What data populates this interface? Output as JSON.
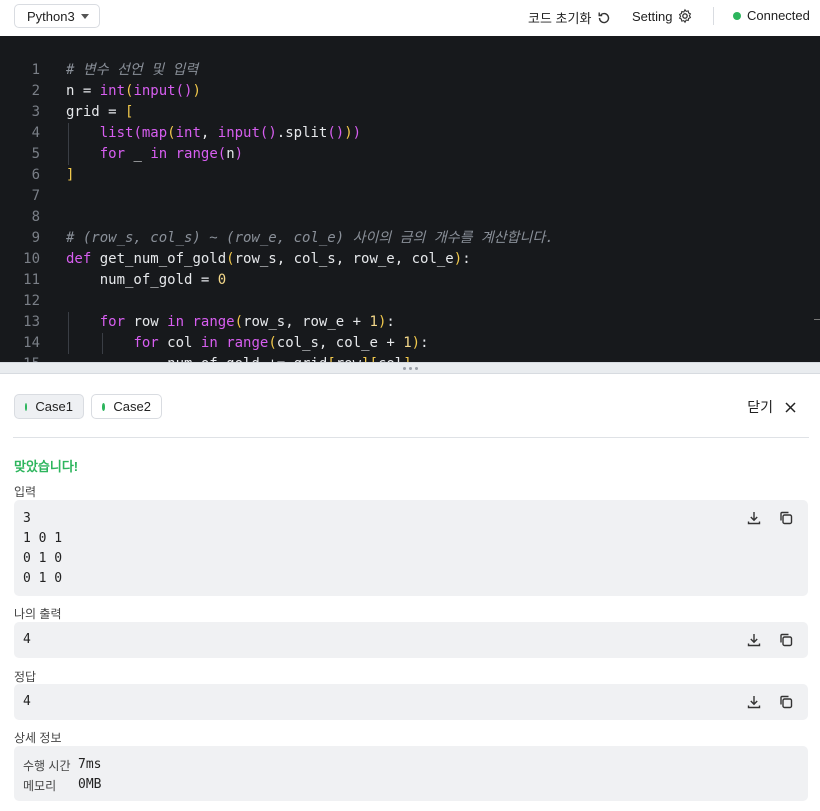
{
  "toolbar": {
    "language": "Python3",
    "reset_label": "코드 초기화",
    "setting_label": "Setting",
    "connection_status": "Connected",
    "status_color": "#2db55d"
  },
  "editor": {
    "lines": [
      {
        "n": "1",
        "tokens": [
          [
            "c-com",
            "# 변수 선언 및 입력"
          ]
        ]
      },
      {
        "n": "2",
        "tokens": [
          [
            "c-txt",
            "n = "
          ],
          [
            "c-fn",
            "int"
          ],
          [
            "c-br1",
            "("
          ],
          [
            "c-fn",
            "input"
          ],
          [
            "c-br2",
            "()"
          ],
          [
            "c-br1",
            ")"
          ]
        ]
      },
      {
        "n": "3",
        "tokens": [
          [
            "c-txt",
            "grid = "
          ],
          [
            "c-br1",
            "["
          ]
        ]
      },
      {
        "n": "4",
        "tokens": [
          [
            "c-txt",
            "    "
          ],
          [
            "c-fn",
            "list"
          ],
          [
            "c-br2",
            "("
          ],
          [
            "c-fn",
            "map"
          ],
          [
            "c-br1",
            "("
          ],
          [
            "c-fn",
            "int"
          ],
          [
            "c-txt",
            ", "
          ],
          [
            "c-fn",
            "input"
          ],
          [
            "c-br2",
            "()"
          ],
          [
            "c-txt",
            ".split"
          ],
          [
            "c-br2",
            "()"
          ],
          [
            "c-br1",
            ")"
          ],
          [
            "c-br2",
            ")"
          ]
        ]
      },
      {
        "n": "5",
        "tokens": [
          [
            "c-txt",
            "    "
          ],
          [
            "c-kw",
            "for"
          ],
          [
            "c-txt",
            " _ "
          ],
          [
            "c-kw",
            "in"
          ],
          [
            "c-txt",
            " "
          ],
          [
            "c-fn",
            "range"
          ],
          [
            "c-br2",
            "("
          ],
          [
            "c-txt",
            "n"
          ],
          [
            "c-br2",
            ")"
          ]
        ]
      },
      {
        "n": "6",
        "tokens": [
          [
            "c-br1",
            "]"
          ]
        ]
      },
      {
        "n": "7",
        "tokens": []
      },
      {
        "n": "8",
        "tokens": []
      },
      {
        "n": "9",
        "tokens": [
          [
            "c-com",
            "# (row_s, col_s) ~ (row_e, col_e) 사이의 금의 개수를 계산합니다."
          ]
        ]
      },
      {
        "n": "10",
        "tokens": [
          [
            "c-kw",
            "def"
          ],
          [
            "c-txt",
            " get_num_of_gold"
          ],
          [
            "c-br1",
            "("
          ],
          [
            "c-txt",
            "row_s, col_s, row_e, col_e"
          ],
          [
            "c-br1",
            ")"
          ],
          [
            "c-txt",
            ":"
          ]
        ]
      },
      {
        "n": "11",
        "tokens": [
          [
            "c-txt",
            "    num_of_gold = "
          ],
          [
            "c-num",
            "0"
          ]
        ]
      },
      {
        "n": "12",
        "tokens": []
      },
      {
        "n": "13",
        "tokens": [
          [
            "c-txt",
            "    "
          ],
          [
            "c-kw",
            "for"
          ],
          [
            "c-txt",
            " row "
          ],
          [
            "c-kw",
            "in"
          ],
          [
            "c-txt",
            " "
          ],
          [
            "c-fn",
            "range"
          ],
          [
            "c-br1",
            "("
          ],
          [
            "c-txt",
            "row_s, row_e + "
          ],
          [
            "c-num",
            "1"
          ],
          [
            "c-br1",
            ")"
          ],
          [
            "c-txt",
            ":"
          ]
        ]
      },
      {
        "n": "14",
        "tokens": [
          [
            "c-txt",
            "        "
          ],
          [
            "c-kw",
            "for"
          ],
          [
            "c-txt",
            " col "
          ],
          [
            "c-kw",
            "in"
          ],
          [
            "c-txt",
            " "
          ],
          [
            "c-fn",
            "range"
          ],
          [
            "c-br1",
            "("
          ],
          [
            "c-txt",
            "col_s, col_e + "
          ],
          [
            "c-num",
            "1"
          ],
          [
            "c-br1",
            ")"
          ],
          [
            "c-txt",
            ":"
          ]
        ]
      },
      {
        "n": "15",
        "tokens": [
          [
            "c-txt",
            "            num_of_gold += grid"
          ],
          [
            "c-br1",
            "["
          ],
          [
            "c-txt",
            "row"
          ],
          [
            "c-br1",
            "]["
          ],
          [
            "c-txt",
            "col"
          ],
          [
            "c-br1",
            "]"
          ]
        ]
      }
    ]
  },
  "panel": {
    "cases": [
      {
        "label": "Case1",
        "status_color": "#2db55d"
      },
      {
        "label": "Case2",
        "status_color": "#2db55d"
      }
    ],
    "close_label": "닫기",
    "result_message": "맞았습니다!",
    "input_label": "입력",
    "input_value": "3\n1 0 1\n0 1 0\n0 1 0",
    "my_output_label": "나의 출력",
    "my_output_value": "4",
    "answer_label": "정답",
    "answer_value": "4",
    "detail_label": "상세 정보",
    "exec_time_label": "수행 시간",
    "exec_time_value": "7ms",
    "memory_label": "메모리",
    "memory_value": "0MB"
  }
}
